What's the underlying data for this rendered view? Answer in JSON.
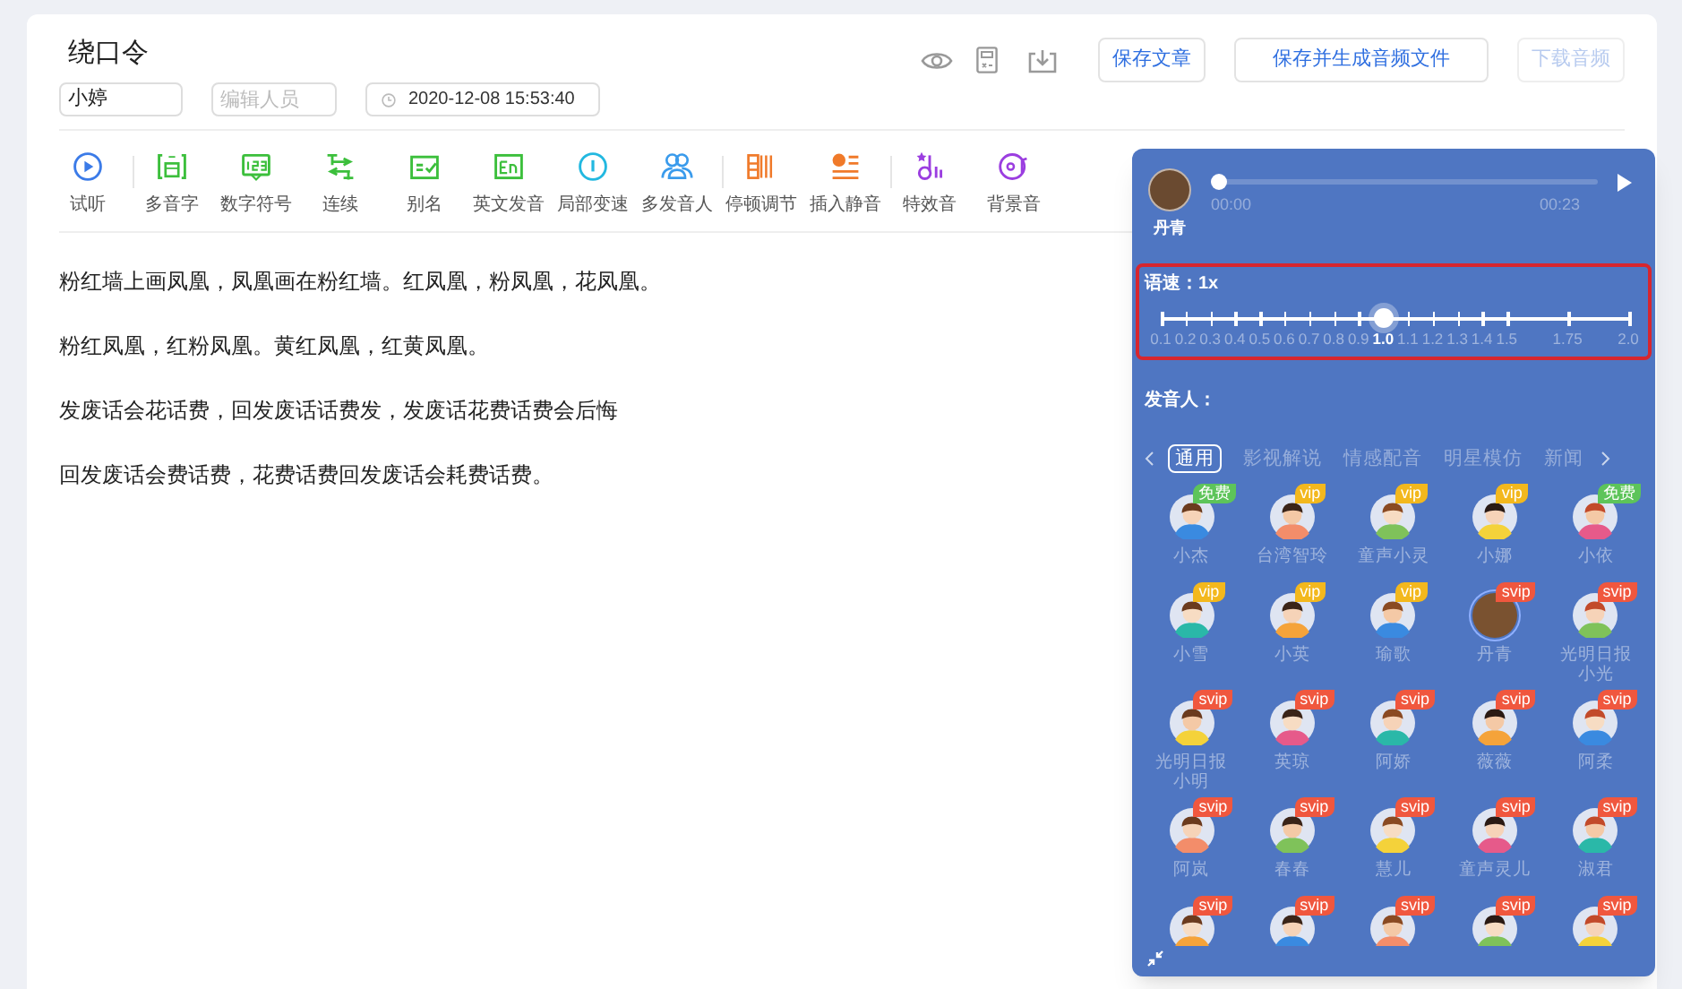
{
  "document": {
    "title": "绕口令",
    "author": "小婷",
    "editor_placeholder": "编辑人员",
    "datetime": "2020-12-08 15:53:40"
  },
  "header_buttons": [
    {
      "label": "保存文章",
      "disabled": false
    },
    {
      "label": "保存并生成音频文件",
      "disabled": false
    },
    {
      "label": "下载音频",
      "disabled": true
    }
  ],
  "toolbar": [
    {
      "kind": "tool",
      "label": "试听",
      "color": "#3b7be8"
    },
    {
      "kind": "divider"
    },
    {
      "kind": "tool",
      "label": "多音字",
      "color": "#3cbf3c"
    },
    {
      "kind": "tool",
      "label": "数字符号",
      "color": "#3cbf3c"
    },
    {
      "kind": "tool",
      "label": "连续",
      "color": "#3cbf3c"
    },
    {
      "kind": "tool",
      "label": "别名",
      "color": "#3cbf3c"
    },
    {
      "kind": "tool",
      "label": "英文发音",
      "color": "#3cbf3c"
    },
    {
      "kind": "tool",
      "label": "局部变速",
      "color": "#22b8e0"
    },
    {
      "kind": "tool",
      "label": "多发音人",
      "color": "#3a9bec"
    },
    {
      "kind": "divider"
    },
    {
      "kind": "tool",
      "label": "停顿调节",
      "color": "#f07a2a"
    },
    {
      "kind": "tool",
      "label": "插入静音",
      "color": "#f07a2a"
    },
    {
      "kind": "divider"
    },
    {
      "kind": "tool",
      "label": "特效音",
      "color": "#9b3ee0"
    },
    {
      "kind": "tool",
      "label": "背景音",
      "color": "#9b3ee0"
    }
  ],
  "paragraphs": [
    "粉红墙上画凤凰，凤凰画在粉红墙。红凤凰，粉凤凰，花凤凰。",
    "粉红凤凰，红粉凤凰。黄红凤凰，红黄凤凰。",
    "发废话会花话费，回发废话话费发，发废话花费话费会后悔",
    "回发废话会费话费，花费话费回发废话会耗费话费。"
  ],
  "voice_panel": {
    "player": {
      "voice": "丹青",
      "elapsed": "00:00",
      "duration": "00:23",
      "level": 0
    },
    "speed": {
      "label": "语速：1x",
      "level": 0.476,
      "ticks": [
        {
          "label": "0.1",
          "selected": false
        },
        {
          "label": "0.2",
          "selected": false
        },
        {
          "label": "0.3",
          "selected": false
        },
        {
          "label": "0.4",
          "selected": false
        },
        {
          "label": "0.5",
          "selected": false
        },
        {
          "label": "0.6",
          "selected": false
        },
        {
          "label": "0.7",
          "selected": false
        },
        {
          "label": "0.8",
          "selected": false
        },
        {
          "label": "0.9",
          "selected": false
        },
        {
          "label": "1.0",
          "selected": true
        },
        {
          "label": "1.1",
          "selected": false
        },
        {
          "label": "1.2",
          "selected": false
        },
        {
          "label": "1.3",
          "selected": false
        },
        {
          "label": "1.4",
          "selected": false
        },
        {
          "label": "1.5",
          "selected": false
        },
        {
          "label": "1.75",
          "selected": false
        },
        {
          "label": "2.0",
          "selected": false
        }
      ]
    },
    "voices_label": "发音人：",
    "categories": [
      {
        "label": "通用",
        "selected": true
      },
      {
        "label": "影视解说",
        "selected": false
      },
      {
        "label": "情感配音",
        "selected": false
      },
      {
        "label": "明星模仿",
        "selected": false
      },
      {
        "label": "新闻",
        "selected": false
      }
    ],
    "voices": [
      {
        "name": "小杰",
        "badge": "免费",
        "kind": "free",
        "selected": false
      },
      {
        "name": "台湾智玲",
        "badge": "vip",
        "kind": "vip",
        "selected": false
      },
      {
        "name": "童声小灵",
        "badge": "vip",
        "kind": "vip",
        "selected": false
      },
      {
        "name": "小娜",
        "badge": "vip",
        "kind": "vip",
        "selected": false
      },
      {
        "name": "小依",
        "badge": "免费",
        "kind": "free",
        "selected": false
      },
      {
        "name": "小雪",
        "badge": "vip",
        "kind": "vip",
        "selected": false
      },
      {
        "name": "小英",
        "badge": "vip",
        "kind": "vip",
        "selected": false
      },
      {
        "name": "瑜歌",
        "badge": "vip",
        "kind": "vip",
        "selected": false
      },
      {
        "name": "丹青",
        "badge": "svip",
        "kind": "svip",
        "selected": true
      },
      {
        "name": "光明日报小光",
        "badge": "svip",
        "kind": "svip",
        "selected": false
      },
      {
        "name": "光明日报小明",
        "badge": "svip",
        "kind": "svip",
        "selected": false
      },
      {
        "name": "英琼",
        "badge": "svip",
        "kind": "svip",
        "selected": false
      },
      {
        "name": "阿娇",
        "badge": "svip",
        "kind": "svip",
        "selected": false
      },
      {
        "name": "薇薇",
        "badge": "svip",
        "kind": "svip",
        "selected": false
      },
      {
        "name": "阿柔",
        "badge": "svip",
        "kind": "svip",
        "selected": false
      },
      {
        "name": "阿岚",
        "badge": "svip",
        "kind": "svip",
        "selected": false
      },
      {
        "name": "春春",
        "badge": "svip",
        "kind": "svip",
        "selected": false
      },
      {
        "name": "慧儿",
        "badge": "svip",
        "kind": "svip",
        "selected": false
      },
      {
        "name": "童声灵儿",
        "badge": "svip",
        "kind": "svip",
        "selected": false
      },
      {
        "name": "淑君",
        "badge": "svip",
        "kind": "svip",
        "selected": false
      },
      {
        "badge": "svip",
        "kind": "svip",
        "selected": false
      },
      {
        "badge": "svip",
        "kind": "svip",
        "selected": false
      },
      {
        "badge": "svip",
        "kind": "svip",
        "selected": false
      },
      {
        "badge": "svip",
        "kind": "svip",
        "selected": false
      },
      {
        "badge": "svip",
        "kind": "svip",
        "selected": false
      }
    ]
  }
}
